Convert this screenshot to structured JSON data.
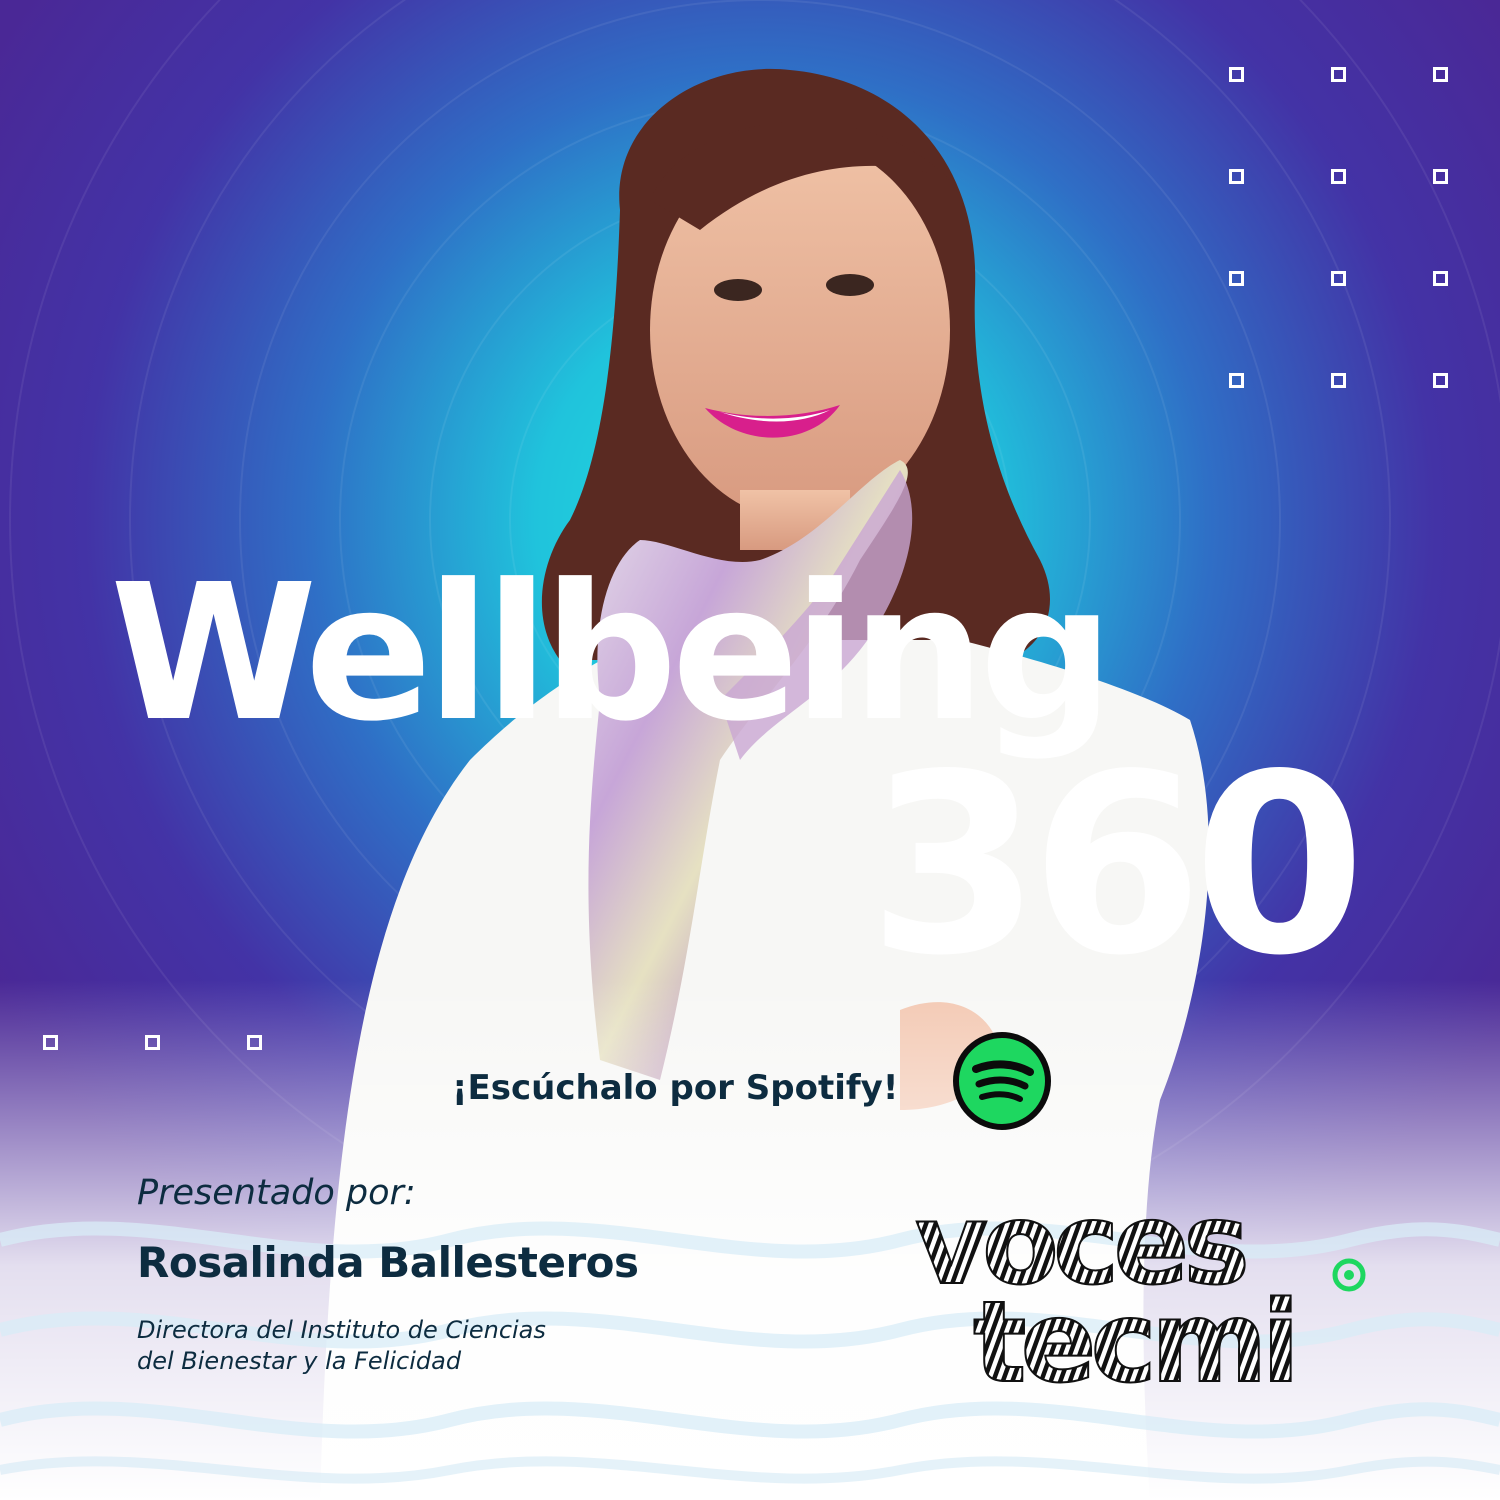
{
  "title": {
    "line1": "Wellbeing",
    "line2": "360"
  },
  "cta": {
    "text": "¡Escúchalo por Spotify!",
    "icon": "spotify-icon"
  },
  "host": {
    "presented_label": "Presentado por:",
    "name": "Rosalinda Ballesteros",
    "role_line1": "Directora del Instituto de Ciencias",
    "role_line2": "del Bienestar y la Felicidad"
  },
  "logo": {
    "line1": "voces",
    "line2": "tecmi"
  },
  "colors": {
    "purple": "#4b2a9a",
    "blue": "#2f72c4",
    "cyan": "#1fd6dd",
    "navy_text": "#0d2c40",
    "spotify_green": "#1ed760",
    "logo_green": "#1ed760"
  }
}
